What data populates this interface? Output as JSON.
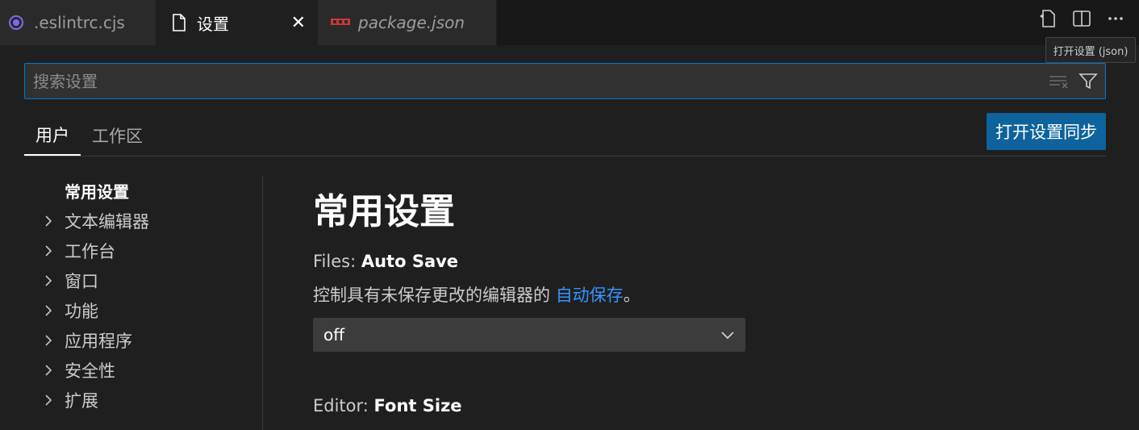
{
  "tabs": [
    {
      "label": ".eslintrc.cjs",
      "icon": "eslint-icon"
    },
    {
      "label": "设置",
      "icon": "file-icon",
      "close": "✕"
    },
    {
      "label": "package.json",
      "icon": "npm-icon"
    }
  ],
  "tooltip": "打开设置 (json)",
  "search": {
    "placeholder": "搜索设置"
  },
  "scope_tabs": [
    "用户",
    "工作区"
  ],
  "sync_button": "打开设置同步",
  "toc": {
    "current": "常用设置",
    "items": [
      "文本编辑器",
      "工作台",
      "窗口",
      "功能",
      "应用程序",
      "安全性",
      "扩展"
    ]
  },
  "main": {
    "section_title": "常用设置",
    "settings": [
      {
        "category": "Files: ",
        "name": "Auto Save",
        "description_prefix": "控制具有未保存更改的编辑器的 ",
        "description_link": "自动保存",
        "description_suffix": "。",
        "value": "off"
      },
      {
        "category": "Editor: ",
        "name": "Font Size"
      }
    ]
  },
  "colors": {
    "accent": "#0078d4",
    "button": "#0e639c",
    "link": "#3794ff"
  }
}
